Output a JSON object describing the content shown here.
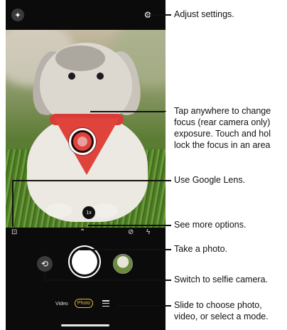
{
  "camera": {
    "zoom_label": "1x",
    "modes": {
      "video": "Video",
      "photo": "Photo"
    },
    "icons": {
      "top_left": "sparkle-icon",
      "settings": "gear-icon",
      "lens": "google-lens-icon",
      "more": "chevron-up-icon",
      "timer": "timer-off-icon",
      "flash": "flash-off-icon",
      "switch": "switch-camera-icon",
      "menu": "menu-icon"
    },
    "accent_color": "#e7b83a"
  },
  "callouts": {
    "settings": "Adjust settings.",
    "focus_lines": [
      "Tap anywhere to change",
      "focus (rear camera only)",
      "exposure. Touch and hol",
      "lock the focus in an area"
    ],
    "lens": "Use Google Lens.",
    "more": "See more options.",
    "photo": "Take a photo.",
    "selfie": "Switch to selfie camera.",
    "mode_lines": [
      "Slide to choose photo,",
      "video, or select a mode."
    ]
  }
}
